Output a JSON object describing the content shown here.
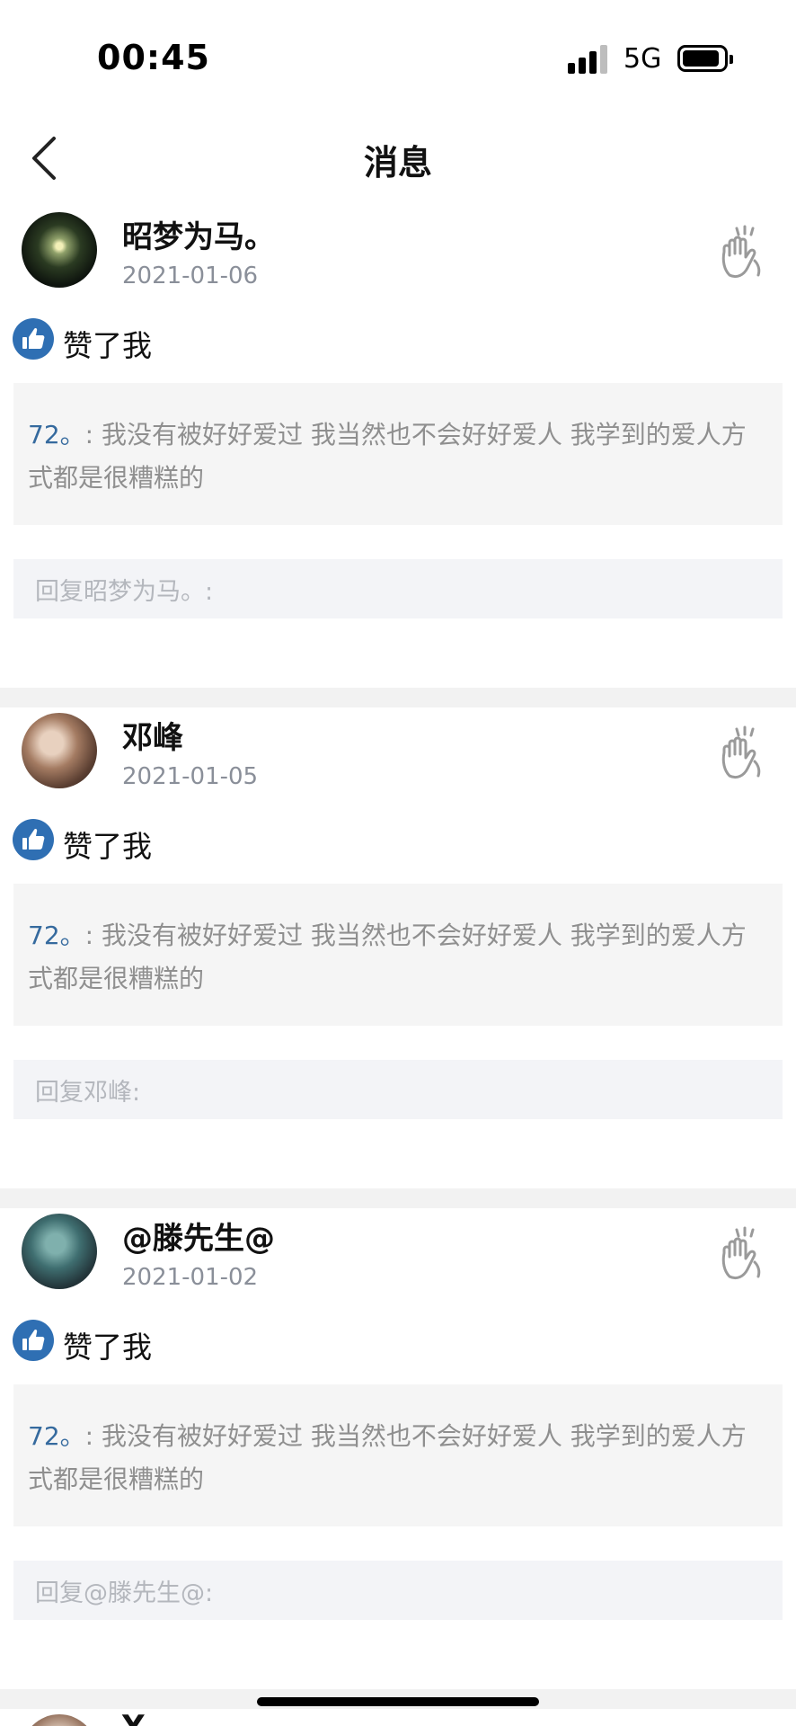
{
  "status_bar": {
    "time": "00:45",
    "network": "5G",
    "signal_icon": "cellular-signal-icon",
    "battery_icon": "battery-icon"
  },
  "nav": {
    "title": "消息",
    "back_icon": "chevron-left-icon"
  },
  "notifications": [
    {
      "username": "昭梦为马。",
      "date": "2021-01-06",
      "action": "赞了我",
      "quote_author": "72。",
      "quote_sep": ": ",
      "quote_text": "我没有被好好爱过 我当然也不会好好爱人 我学到的爱人方式都是很糟糕的",
      "reply_placeholder": "回复昭梦为马。:"
    },
    {
      "username": "邓峰",
      "date": "2021-01-05",
      "action": "赞了我",
      "quote_author": "72。",
      "quote_sep": ": ",
      "quote_text": "我没有被好好爱过 我当然也不会好好爱人 我学到的爱人方式都是很糟糕的",
      "reply_placeholder": "回复邓峰:"
    },
    {
      "username": "@滕先生@",
      "date": "2021-01-02",
      "action": "赞了我",
      "quote_author": "72。",
      "quote_sep": ": ",
      "quote_text": "我没有被好好爱过 我当然也不会好好爱人 我学到的爱人方式都是很糟糕的",
      "reply_placeholder": "回复@滕先生@:"
    }
  ],
  "partial_next": {
    "username": "Y"
  },
  "icons": {
    "like": "thumbs-up-icon",
    "wave": "waving-hand-icon"
  },
  "colors": {
    "accent": "#2f6fb3",
    "quote_author": "#356a9e",
    "quote_text": "#8f8f8f",
    "date": "#8a8f99",
    "separator": "#f2f2f2"
  }
}
